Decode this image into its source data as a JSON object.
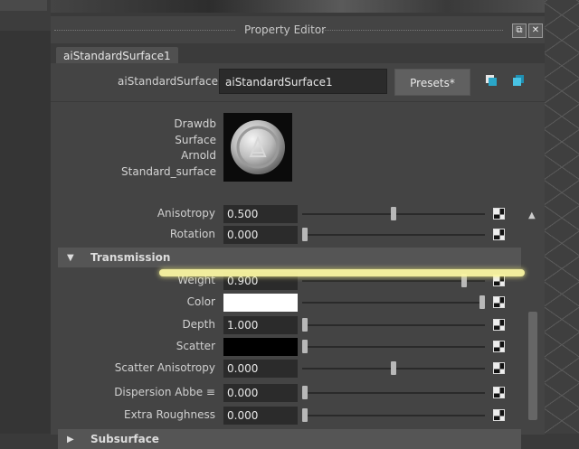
{
  "window": {
    "title": "Property Editor"
  },
  "tab": {
    "label": "aiStandardSurface1"
  },
  "header": {
    "type_label": "aiStandardSurface:",
    "name_value": "aiStandardSurface1",
    "presets_label": "Presets*"
  },
  "node_info": {
    "lines": [
      "Drawdb",
      "Surface",
      "Arnold",
      "Standard_surface"
    ]
  },
  "specular_rows": {
    "anisotropy": {
      "label": "Anisotropy",
      "value": "0.500",
      "fraction": 0.5
    },
    "rotation": {
      "label": "Rotation",
      "value": "0.000",
      "fraction": 0.0
    }
  },
  "sections": {
    "transmission": "Transmission",
    "subsurface": "Subsurface"
  },
  "transmission": {
    "weight": {
      "label": "Weight",
      "value": "0.900",
      "fraction": 0.9
    },
    "color": {
      "label": "Color",
      "color": "#ffffff",
      "fraction": 1.0
    },
    "depth": {
      "label": "Depth",
      "value": "1.000",
      "fraction": 0.0
    },
    "scatter": {
      "label": "Scatter",
      "color": "#000000",
      "fraction": 0.0
    },
    "scatter_anisotropy": {
      "label": "Scatter Anisotropy",
      "value": "0.000",
      "fraction": 0.5
    },
    "dispersion_abbe": {
      "label": "Dispersion Abbe ≡",
      "value": "0.000",
      "fraction": 0.0
    },
    "extra_roughness": {
      "label": "Extra Roughness",
      "value": "0.000",
      "fraction": 0.0
    }
  },
  "icons": {
    "panel_float": "float-window-icon",
    "panel_close": "close-icon",
    "copy_tab": "copy-tab-icon",
    "show_hide": "show-attributes-icon",
    "map_button": "checker-map-icon",
    "section_expanded": "triangle-down-icon",
    "section_collapsed": "triangle-right-icon",
    "scroll_up": "scroll-up-icon"
  },
  "colors": {
    "highlight": "#fbf7a2",
    "panel_bg": "#444444",
    "field_bg": "#2b2b2b"
  }
}
